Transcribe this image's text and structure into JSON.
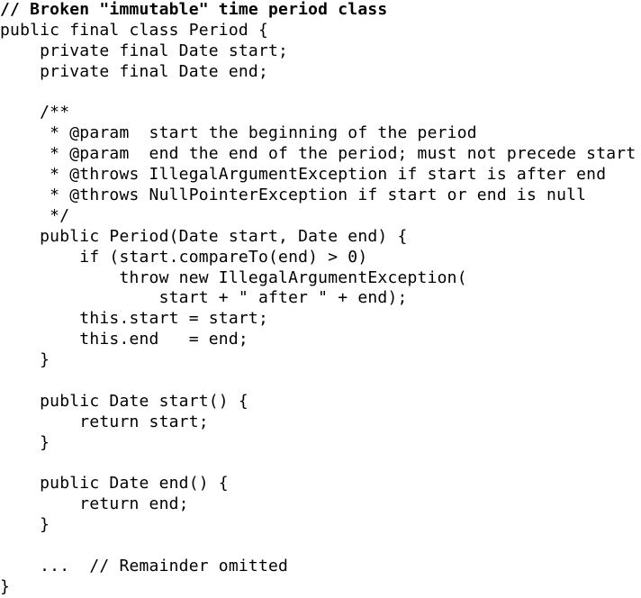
{
  "code": {
    "lines": [
      "// Broken \"immutable\" time period class",
      "public final class Period {",
      "    private final Date start;",
      "    private final Date end;",
      "",
      "    /**",
      "     * @param  start the beginning of the period",
      "     * @param  end the end of the period; must not precede start",
      "     * @throws IllegalArgumentException if start is after end",
      "     * @throws NullPointerException if start or end is null",
      "     */",
      "    public Period(Date start, Date end) {",
      "        if (start.compareTo(end) > 0)",
      "            throw new IllegalArgumentException(",
      "                start + \" after \" + end);",
      "        this.start = start;",
      "        this.end   = end;",
      "    }",
      "",
      "    public Date start() {",
      "        return start;",
      "    }",
      "",
      "    public Date end() {",
      "        return end;",
      "    }",
      "",
      "    ...  // Remainder omitted",
      "}"
    ]
  }
}
